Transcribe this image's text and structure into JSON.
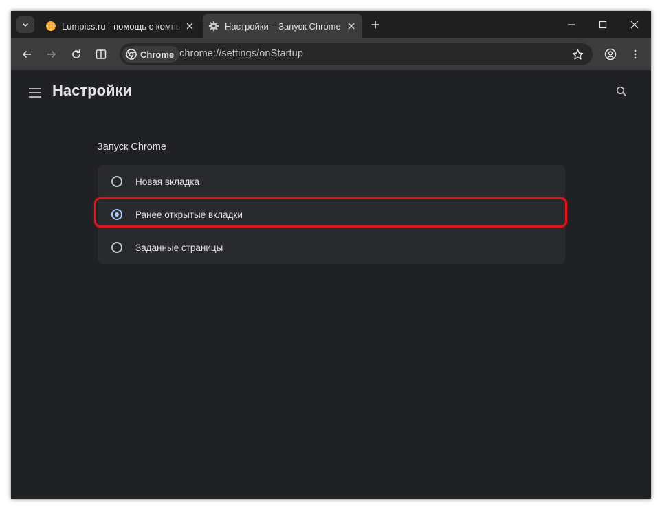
{
  "tabs": [
    {
      "title": "Lumpics.ru - помощь с компьютером",
      "favicon": "orange-circle-icon",
      "active": false
    },
    {
      "title": "Настройки – Запуск Chrome",
      "favicon": "gear-icon",
      "active": true
    }
  ],
  "omnibox": {
    "chip_label": "Chrome",
    "url": "chrome://settings/onStartup"
  },
  "settings": {
    "title": "Настройки",
    "section_title": "Запуск Chrome",
    "options": [
      {
        "label": "Новая вкладка",
        "checked": false
      },
      {
        "label": "Ранее открытые вкладки",
        "checked": true
      },
      {
        "label": "Заданные страницы",
        "checked": false
      }
    ]
  },
  "colors": {
    "page_bg": "#202124",
    "card_bg": "#292a2d",
    "accent": "#a8c7fa",
    "highlight": "#e0141b"
  }
}
